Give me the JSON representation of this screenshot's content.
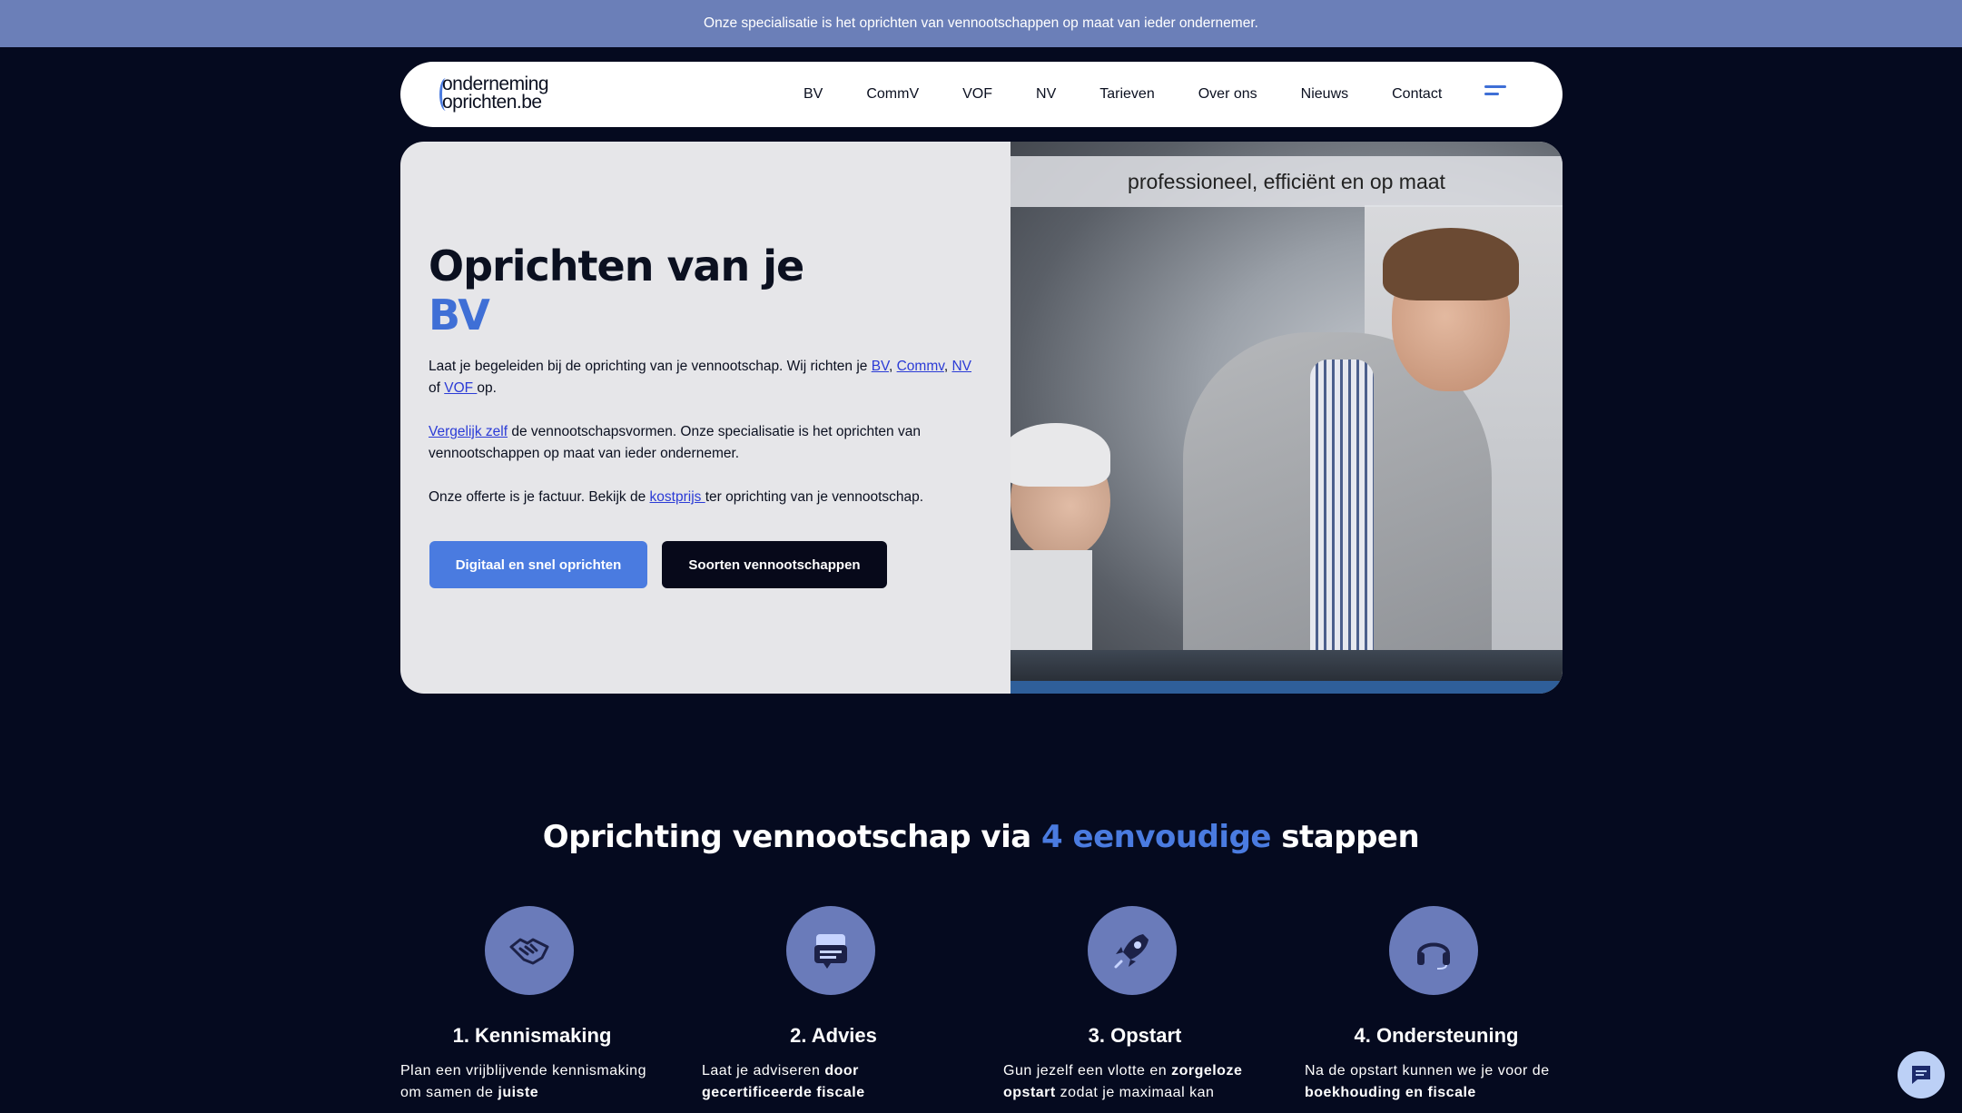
{
  "announcement": "Onze specialisatie is het oprichten van vennootschappen op maat van ieder ondernemer.",
  "logo": {
    "line1": "onderneming",
    "line2": "oprichten.be"
  },
  "nav": {
    "items": [
      "BV",
      "CommV",
      "VOF",
      "NV",
      "Tarieven",
      "Over ons",
      "Nieuws",
      "Contact"
    ]
  },
  "hero": {
    "title_line1": "Oprichten van je",
    "title_accent": "BV",
    "p1_text1": "Laat je begeleiden bij de oprichting van je vennootschap. Wij richten je ",
    "p1_link_bv": "BV",
    "p1_sep1": ", ",
    "p1_link_commv": "Commv",
    "p1_sep2": ", ",
    "p1_link_nv": "NV",
    "p1_of": " of ",
    "p1_link_vof": "VOF ",
    "p1_end": "op.",
    "p2_link": "Vergelijk zelf",
    "p2_text": " de vennootschapsvormen. Onze specialisatie is het oprichten van vennootschappen op maat van ieder ondernemer.",
    "p3_text": "Onze offerte is je factuur. Bekijk de ",
    "p3_link": "kostprijs ",
    "p3_end": "ter oprichting van je vennootschap.",
    "btn_primary": "Digitaal en snel oprichten",
    "btn_dark": "Soorten vennootschappen",
    "image_caption": "professioneel, efficiënt en op maat"
  },
  "steps_section": {
    "title_start": "Oprichting vennootschap via ",
    "title_accent": "4 eenvoudige",
    "title_end": " stappen"
  },
  "steps": [
    {
      "icon": "handshake-icon",
      "title": "1. Kennismaking",
      "d1": "Plan een vrijblijvende kennismaking om samen de ",
      "b1": "juiste"
    },
    {
      "icon": "chat-icon",
      "title": "2. Advies",
      "d1": "Laat je adviseren ",
      "b1": "door gecertificeerde fiscale"
    },
    {
      "icon": "rocket-icon",
      "title": "3. Opstart",
      "d1": "Gun jezelf een vlotte en ",
      "b1": "zorgeloze opstart",
      "d2": " zodat je maximaal kan"
    },
    {
      "icon": "headset-icon",
      "title": "4. Ondersteuning",
      "d1": "Na de opstart kunnen we je voor de ",
      "b1": "boekhouding en fiscale"
    }
  ],
  "colors": {
    "accent": "#4a7be0",
    "dark_bg": "#050a1f",
    "topbar": "#6b7fb8",
    "icon_circle": "#6a7bba"
  }
}
